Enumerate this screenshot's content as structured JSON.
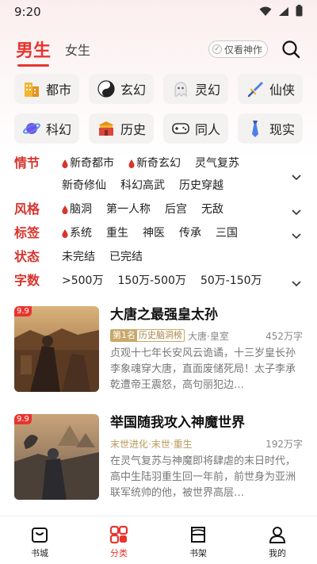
{
  "status": {
    "time": "9:20"
  },
  "header": {
    "tab_male": "男生",
    "tab_female": "女生",
    "toggle": "仅看神作"
  },
  "categories": [
    {
      "label": "都市",
      "icon": "building-icon"
    },
    {
      "label": "玄幻",
      "icon": "yin-yang-icon"
    },
    {
      "label": "灵幻",
      "icon": "ghost-icon"
    },
    {
      "label": "仙侠",
      "icon": "sword-icon"
    },
    {
      "label": "科幻",
      "icon": "planet-icon"
    },
    {
      "label": "历史",
      "icon": "palace-icon"
    },
    {
      "label": "同人",
      "icon": "gamepad-icon"
    },
    {
      "label": "现实",
      "icon": "tie-icon"
    }
  ],
  "filters": {
    "plot": {
      "label": "情节",
      "options": [
        "新奇都市",
        "新奇玄幻",
        "灵气复苏",
        "新奇修仙",
        "科幻高武",
        "历史穿越"
      ]
    },
    "style": {
      "label": "风格",
      "options": [
        "脑洞",
        "第一人称",
        "后宫",
        "无敌"
      ]
    },
    "tags": {
      "label": "标签",
      "options": [
        "系统",
        "重生",
        "神医",
        "传承",
        "三国"
      ]
    },
    "state": {
      "label": "状态",
      "options": [
        "未完结",
        "已完结"
      ]
    },
    "words": {
      "label": "字数",
      "options": [
        ">500万",
        "150万-500万",
        "50万-150万"
      ]
    }
  },
  "books": [
    {
      "score": "9.9",
      "title": "大唐之最强皇太孙",
      "rank": "第1名",
      "rank_list": "历史脑洞榜",
      "tags": "大唐·皇室",
      "words": "452万字",
      "desc": "贞观十七年长安风云诡谲，十三岁皇长孙李象魂穿大唐，直面废储死局！太子李承乾遭帝王震怒，高句丽犯边…"
    },
    {
      "score": "9.9",
      "title": "举国随我攻入神魔世界",
      "tags": "末世进化·末世·重生",
      "words": "192万字",
      "desc": "在灵气复苏与神魔即将肆虐的末日时代，高中生陆羽重生回一年前，前世身为亚洲联军统帅的他，被世界高层…"
    }
  ],
  "nav": [
    {
      "label": "书城",
      "icon": "bookstore-icon"
    },
    {
      "label": "分类",
      "icon": "category-icon"
    },
    {
      "label": "书架",
      "icon": "bookshelf-icon"
    },
    {
      "label": "我的",
      "icon": "profile-icon"
    }
  ],
  "colors": {
    "accent": "#e8342f",
    "label_red": "#d7342c",
    "gold": "#c9a86a"
  }
}
